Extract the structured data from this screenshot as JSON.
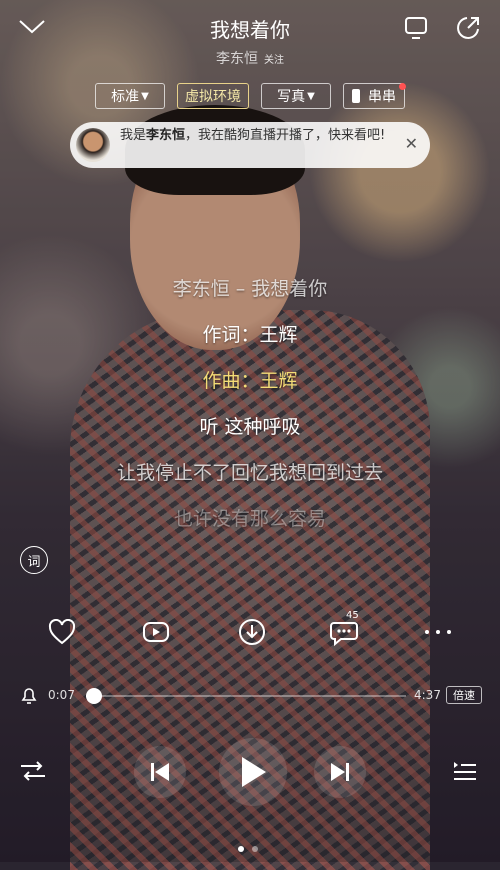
{
  "header": {
    "song_title": "我想着你",
    "artist": "李东恒",
    "follow_label": "关注"
  },
  "modes": [
    {
      "label": "标准",
      "has_dropdown": true,
      "active": false
    },
    {
      "label": "虚拟环境",
      "has_dropdown": false,
      "active": true
    },
    {
      "label": "写真",
      "has_dropdown": true,
      "active": false
    },
    {
      "label": "串串",
      "has_dropdown": false,
      "active": false,
      "has_dot": true
    }
  ],
  "notice": {
    "prefix": "我是",
    "name": "李东恒",
    "suffix": "，我在酷狗直播开播了，快来看吧!"
  },
  "lyrics": [
    "李东恒 – 我想着你",
    "作词：王辉",
    "作曲：王辉",
    "听 这种呼吸",
    "让我停止不了回忆我想回到过去",
    "也许没有那么容易"
  ],
  "side": {
    "lyrics_toggle_label": "词"
  },
  "actions": {
    "comment_count": "45"
  },
  "player": {
    "elapsed": "0:07",
    "duration": "4:37",
    "progress": 0.025,
    "speed_label": "倍速"
  },
  "pager": {
    "count": 2,
    "active": 0
  },
  "colors": {
    "lyric_highlight": "#f3dc76",
    "mode_active": "#e8d28a",
    "badge_dot": "#ff5252"
  }
}
